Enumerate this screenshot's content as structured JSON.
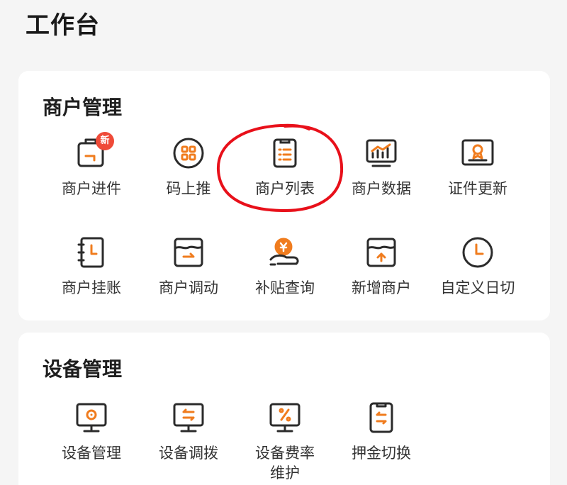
{
  "page": {
    "title": "工作台"
  },
  "colors": {
    "accent": "#f07c1e",
    "stroke": "#2b2b2b",
    "badge": "#ef4a38",
    "annotation": "#e8101a"
  },
  "merchant": {
    "title": "商户管理",
    "items": [
      {
        "label": "商户进件",
        "icon": "clipboard-arrow-icon",
        "badge": "新"
      },
      {
        "label": "码上推",
        "icon": "qr-grid-circle-icon"
      },
      {
        "label": "商户列表",
        "icon": "list-document-icon"
      },
      {
        "label": "商户数据",
        "icon": "chart-monitor-icon"
      },
      {
        "label": "证件更新",
        "icon": "certificate-icon"
      },
      {
        "label": "商户挂账",
        "icon": "ledger-clock-icon"
      },
      {
        "label": "商户调动",
        "icon": "inbox-transfer-icon"
      },
      {
        "label": "补贴查询",
        "icon": "coin-hand-icon"
      },
      {
        "label": "新增商户",
        "icon": "inbox-upload-icon"
      },
      {
        "label": "自定义日切",
        "icon": "clock-icon"
      }
    ]
  },
  "device": {
    "title": "设备管理",
    "items": [
      {
        "label": "设备管理",
        "icon": "monitor-gear-icon"
      },
      {
        "label": "设备调拨",
        "icon": "monitor-swap-icon"
      },
      {
        "label": "设备费率\n维护",
        "icon": "monitor-percent-icon"
      },
      {
        "label": "押金切换",
        "icon": "phone-swap-icon"
      }
    ]
  }
}
